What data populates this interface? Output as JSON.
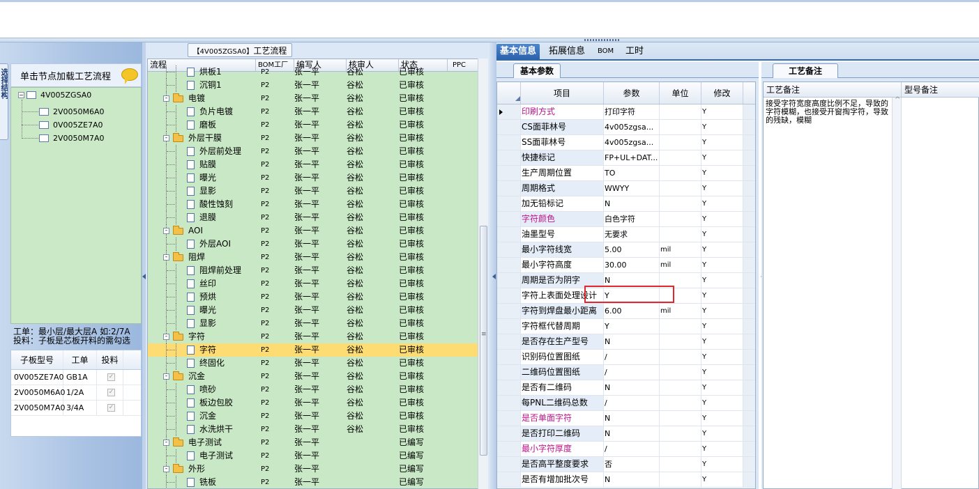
{
  "left_panel": {
    "vertical_tab": "选择结构",
    "hint": "单击节点加载工艺流程",
    "tree": {
      "root": "4V005ZGSA0",
      "children": [
        "2V0050M6A0",
        "0V005ZE7A0",
        "2V0050M7A0"
      ]
    },
    "note_line1": "工单：最小层/最大层A 如:2/7A",
    "note_line2": "投料：子板是芯板开料的需勾选",
    "grid": {
      "headers": [
        "子板型号",
        "工单",
        "投料"
      ],
      "rows": [
        {
          "model": "0V005ZE7A0",
          "order": "GB1A",
          "feed": "✓"
        },
        {
          "model": "2V0050M6A0",
          "order": "1/2A",
          "feed": "✓"
        },
        {
          "model": "2V0050M7A0",
          "order": "3/4A",
          "feed": "✓"
        }
      ]
    }
  },
  "middle_panel": {
    "title_code": "【4V005ZGSA0】",
    "title_text": "工艺流程",
    "headers": [
      "流程",
      "BOM工厂",
      "编写人",
      "核审人",
      "状态",
      "PPC"
    ],
    "rows": [
      {
        "name": "烘板1",
        "type": "leaf",
        "bom": "P2",
        "writer": "张一平",
        "checker": "谷松",
        "status": "已审核"
      },
      {
        "name": "沉铜1",
        "type": "leaf",
        "bom": "P2",
        "writer": "张一平",
        "checker": "谷松",
        "status": "已审核"
      },
      {
        "name": "电镀",
        "type": "folder",
        "bom": "P2",
        "writer": "张一平",
        "checker": "谷松",
        "status": "已审核"
      },
      {
        "name": "负片电镀",
        "type": "leaf",
        "bom": "P2",
        "writer": "张一平",
        "checker": "谷松",
        "status": "已审核"
      },
      {
        "name": "磨板",
        "type": "leaf",
        "bom": "P2",
        "writer": "张一平",
        "checker": "谷松",
        "status": "已审核"
      },
      {
        "name": "外层干膜",
        "type": "folder",
        "bom": "P2",
        "writer": "张一平",
        "checker": "谷松",
        "status": "已审核"
      },
      {
        "name": "外层前处理",
        "type": "leaf",
        "bom": "P2",
        "writer": "张一平",
        "checker": "谷松",
        "status": "已审核"
      },
      {
        "name": "贴膜",
        "type": "leaf",
        "bom": "P2",
        "writer": "张一平",
        "checker": "谷松",
        "status": "已审核"
      },
      {
        "name": "曝光",
        "type": "leaf",
        "bom": "P2",
        "writer": "张一平",
        "checker": "谷松",
        "status": "已审核"
      },
      {
        "name": "显影",
        "type": "leaf",
        "bom": "P2",
        "writer": "张一平",
        "checker": "谷松",
        "status": "已审核"
      },
      {
        "name": "酸性蚀刻",
        "type": "leaf",
        "bom": "P2",
        "writer": "张一平",
        "checker": "谷松",
        "status": "已审核"
      },
      {
        "name": "退膜",
        "type": "leaf",
        "bom": "P2",
        "writer": "张一平",
        "checker": "谷松",
        "status": "已审核"
      },
      {
        "name": "AOI",
        "type": "folder",
        "bom": "P2",
        "writer": "张一平",
        "checker": "谷松",
        "status": "已审核"
      },
      {
        "name": "外层AOI",
        "type": "leaf",
        "bom": "P2",
        "writer": "张一平",
        "checker": "谷松",
        "status": "已审核"
      },
      {
        "name": "阻焊",
        "type": "folder",
        "bom": "P2",
        "writer": "张一平",
        "checker": "谷松",
        "status": "已审核"
      },
      {
        "name": "阻焊前处理",
        "type": "leaf",
        "bom": "P2",
        "writer": "张一平",
        "checker": "谷松",
        "status": "已审核"
      },
      {
        "name": "丝印",
        "type": "leaf",
        "bom": "P2",
        "writer": "张一平",
        "checker": "谷松",
        "status": "已审核"
      },
      {
        "name": "预烘",
        "type": "leaf",
        "bom": "P2",
        "writer": "张一平",
        "checker": "谷松",
        "status": "已审核"
      },
      {
        "name": "曝光",
        "type": "leaf",
        "bom": "P2",
        "writer": "张一平",
        "checker": "谷松",
        "status": "已审核"
      },
      {
        "name": "显影",
        "type": "leaf",
        "bom": "P2",
        "writer": "张一平",
        "checker": "谷松",
        "status": "已审核"
      },
      {
        "name": "字符",
        "type": "folder",
        "bom": "P2",
        "writer": "张一平",
        "checker": "谷松",
        "status": "已审核"
      },
      {
        "name": "字符",
        "type": "leaf",
        "bom": "P2",
        "writer": "张一平",
        "checker": "谷松",
        "status": "已审核",
        "selected": true
      },
      {
        "name": "终固化",
        "type": "leaf",
        "bom": "P2",
        "writer": "张一平",
        "checker": "谷松",
        "status": "已审核"
      },
      {
        "name": "沉金",
        "type": "folder",
        "bom": "P2",
        "writer": "张一平",
        "checker": "谷松",
        "status": "已审核"
      },
      {
        "name": "喷砂",
        "type": "leaf",
        "bom": "P2",
        "writer": "张一平",
        "checker": "谷松",
        "status": "已审核"
      },
      {
        "name": "板边包胶",
        "type": "leaf",
        "bom": "P2",
        "writer": "张一平",
        "checker": "谷松",
        "status": "已审核"
      },
      {
        "name": "沉金",
        "type": "leaf",
        "bom": "P2",
        "writer": "张一平",
        "checker": "谷松",
        "status": "已审核"
      },
      {
        "name": "水洗烘干",
        "type": "leaf",
        "bom": "P2",
        "writer": "张一平",
        "checker": "谷松",
        "status": "已审核"
      },
      {
        "name": "电子测试",
        "type": "folder",
        "bom": "P2",
        "writer": "张一平",
        "checker": "",
        "status": "已编写"
      },
      {
        "name": "电子测试",
        "type": "leaf",
        "bom": "P2",
        "writer": "张一平",
        "checker": "",
        "status": "已编写"
      },
      {
        "name": "外形",
        "type": "folder",
        "bom": "P2",
        "writer": "张一平",
        "checker": "",
        "status": "已编写"
      },
      {
        "name": "铣板",
        "type": "leaf",
        "bom": "P2",
        "writer": "张一平",
        "checker": "",
        "status": "已编写"
      }
    ]
  },
  "right_tabs": [
    "基本信息",
    "拓展信息",
    "BOM",
    "工时"
  ],
  "basic_params": {
    "subtab": "基本参数",
    "headers": [
      "项目",
      "参数",
      "单位",
      "修改"
    ],
    "rows": [
      {
        "item": "印刷方式",
        "param": "打印字符",
        "unit": "",
        "mod": "Y",
        "magenta": true,
        "current": true
      },
      {
        "item": "CS面菲林号",
        "param": "4v005zgsa...",
        "unit": "",
        "mod": "Y"
      },
      {
        "item": "SS面菲林号",
        "param": "4v005zgsa...",
        "unit": "",
        "mod": "Y"
      },
      {
        "item": "快捷标记",
        "param": "FP+UL+DAT...",
        "unit": "",
        "mod": "Y"
      },
      {
        "item": "生产周期位置",
        "param": "TO",
        "unit": "",
        "mod": "Y"
      },
      {
        "item": "周期格式",
        "param": "WWYY",
        "unit": "",
        "mod": "Y"
      },
      {
        "item": "加无铅标记",
        "param": "N",
        "unit": "",
        "mod": "Y"
      },
      {
        "item": "字符颜色",
        "param": "白色字符",
        "unit": "",
        "mod": "Y",
        "magenta": true
      },
      {
        "item": "油墨型号",
        "param": "无要求",
        "unit": "",
        "mod": "Y"
      },
      {
        "item": "最小字符线宽",
        "param": "5.00",
        "unit": "mil",
        "mod": "Y"
      },
      {
        "item": "最小字符高度",
        "param": "30.00",
        "unit": "mil",
        "mod": "Y"
      },
      {
        "item": "周期是否为阴字",
        "param": "N",
        "unit": "",
        "mod": "Y"
      },
      {
        "item": "字符上表面处理设计",
        "param": "Y",
        "unit": "",
        "mod": "Y"
      },
      {
        "item": "字符到焊盘最小距离",
        "param": "6.00",
        "unit": "mil",
        "mod": "Y"
      },
      {
        "item": "字符框代替周期",
        "param": "Y",
        "unit": "",
        "mod": "Y"
      },
      {
        "item": "是否存在生产型号",
        "param": "N",
        "unit": "",
        "mod": "Y"
      },
      {
        "item": "识别码位置图纸",
        "param": "/",
        "unit": "",
        "mod": "Y"
      },
      {
        "item": "二维码位置图纸",
        "param": "/",
        "unit": "",
        "mod": "Y"
      },
      {
        "item": "是否有二维码",
        "param": "N",
        "unit": "",
        "mod": "Y"
      },
      {
        "item": "每PNL二维码总数",
        "param": "/",
        "unit": "",
        "mod": "Y"
      },
      {
        "item": "是否单面字符",
        "param": "N",
        "unit": "",
        "mod": "Y",
        "magenta": true
      },
      {
        "item": "是否打印二维码",
        "param": "N",
        "unit": "",
        "mod": "Y"
      },
      {
        "item": "最小字符厚度",
        "param": "/",
        "unit": "",
        "mod": "Y",
        "magenta": true
      },
      {
        "item": "是否高平整度要求",
        "param": "否",
        "unit": "",
        "mod": "Y"
      },
      {
        "item": "是否有增加批次号",
        "param": "N",
        "unit": "",
        "mod": "Y"
      }
    ]
  },
  "process_remarks": {
    "tab": "工艺备注",
    "headers": [
      "工艺备注",
      "型号备注"
    ],
    "text": "接受字符宽度高度比例不足，导致的字符模糊，也接受开窗掏字符，导致的残缺，模糊"
  }
}
